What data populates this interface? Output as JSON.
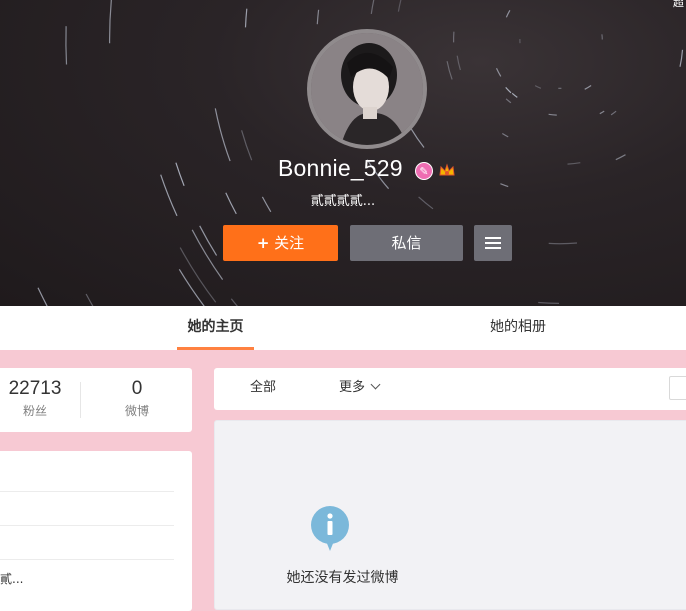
{
  "profile": {
    "username": "Bonnie_529",
    "signature": "貳貳貳貳...",
    "badges": [
      "verified-pink-icon",
      "crown-icon"
    ]
  },
  "actions": {
    "follow_label": "关注",
    "message_label": "私信"
  },
  "tabs": [
    {
      "label": "她的主页"
    },
    {
      "label": "她的相册"
    }
  ],
  "stats": {
    "fans": {
      "value": "22713",
      "label": "粉丝"
    },
    "weibo": {
      "value": "0",
      "label": "微博"
    }
  },
  "info": {
    "truncated_text": "貳..."
  },
  "filters": {
    "all": "全部",
    "more": "更多"
  },
  "feed": {
    "empty_text": "她还没有发过微博"
  },
  "corner": {
    "text": "超"
  },
  "colors": {
    "accent": "#ff7019",
    "page_bg": "#f7c9d3",
    "tab_underline": "#ff8140",
    "info_icon": "#7bb8da"
  }
}
